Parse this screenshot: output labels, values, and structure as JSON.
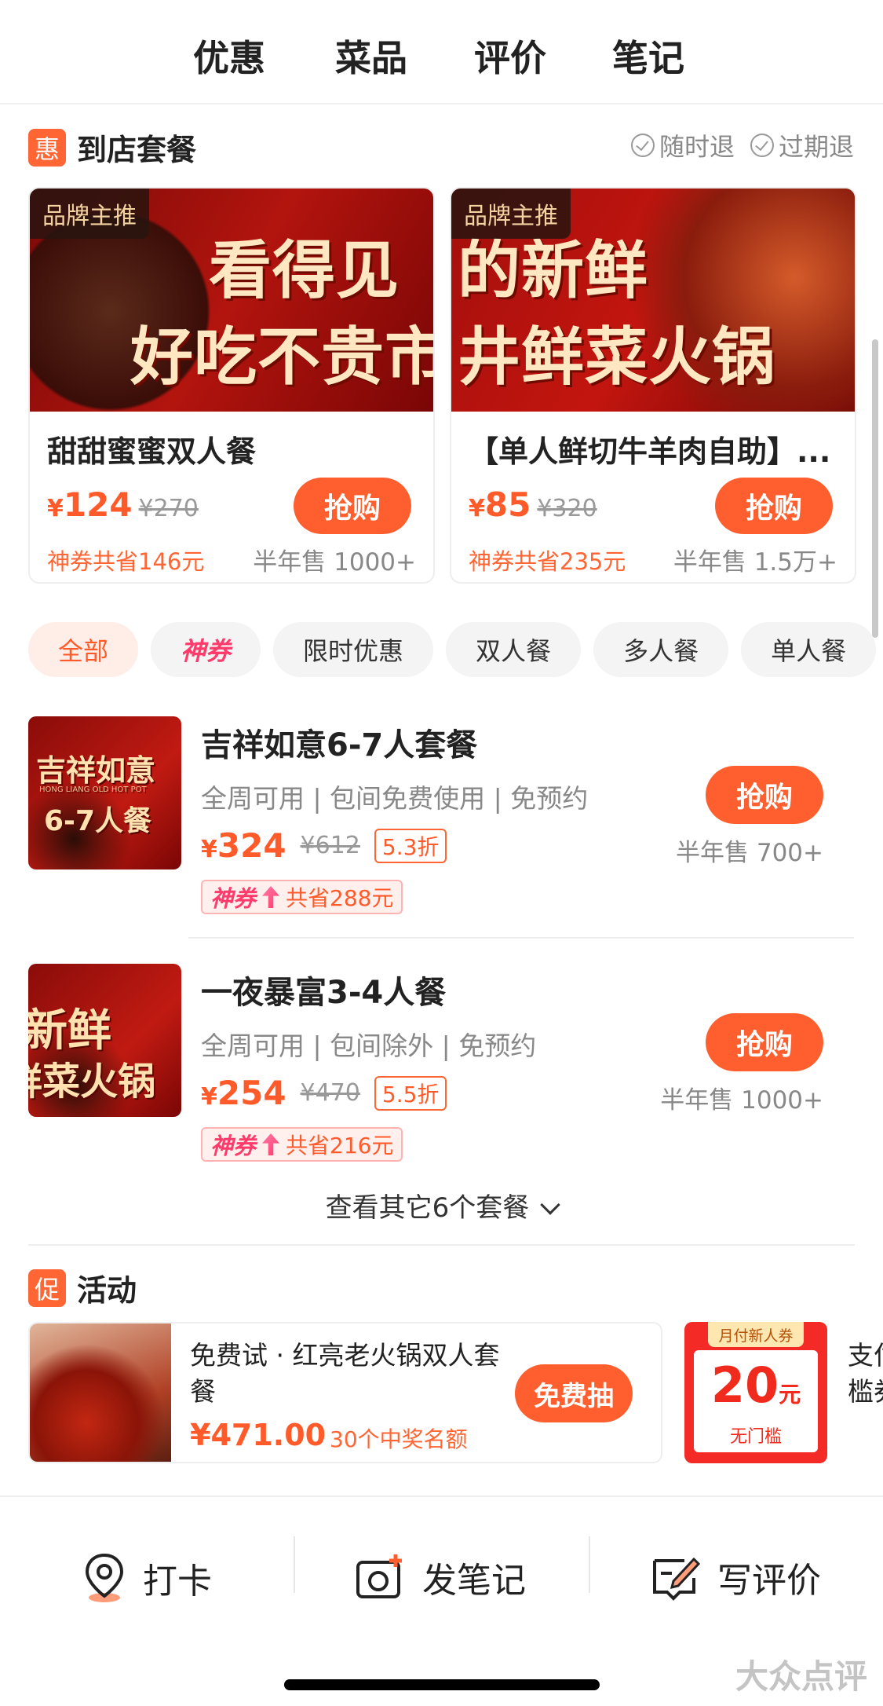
{
  "tabs": [
    {
      "label": "优惠",
      "active": true
    },
    {
      "label": "菜品",
      "active": false
    },
    {
      "label": "评价",
      "active": false
    },
    {
      "label": "笔记",
      "active": false
    }
  ],
  "package_section": {
    "badge": "惠",
    "title": "到店套餐",
    "policies": [
      "随时退",
      "过期退"
    ]
  },
  "featured": [
    {
      "tag": "品牌主推",
      "banner_line1": "看得见",
      "banner_line2": "好吃不贵市",
      "name": "甜甜蜜蜜双人餐",
      "currency": "¥",
      "price": "124",
      "original": "¥270",
      "buy": "抢购",
      "savings": "神券共省146元",
      "sold": "半年售 1000+"
    },
    {
      "tag": "品牌主推",
      "banner_line1": "的新鲜",
      "banner_line2": "井鲜菜火锅",
      "name": "【单人鲜切牛羊肉自助】...",
      "currency": "¥",
      "price": "85",
      "original": "¥320",
      "buy": "抢购",
      "savings": "神券共省235元",
      "sold": "半年售 1.5万+"
    }
  ],
  "filters": [
    {
      "label": "全部",
      "active": true
    },
    {
      "label": "神券",
      "special": true
    },
    {
      "label": "限时优惠"
    },
    {
      "label": "双人餐"
    },
    {
      "label": "多人餐"
    },
    {
      "label": "单人餐"
    }
  ],
  "deals": [
    {
      "img_line1": "吉祥如意",
      "img_line2": "6-7人餐",
      "img_small": "HONG LIANG OLD HOT POT",
      "title": "吉祥如意6-7人套餐",
      "sub": "全周可用 | 包间免费使用 | 免预约",
      "currency": "¥",
      "price": "324",
      "original": "¥612",
      "discount": "5.3折",
      "coupon_logo": "神券",
      "coupon_text": "共省288元",
      "buy": "抢购",
      "sold": "半年售 700+"
    },
    {
      "img_line1": "新鲜",
      "img_line2": "鲜菜火锅",
      "title": "一夜暴富3-4人餐",
      "sub": "全周可用 | 包间除外 | 免预约",
      "currency": "¥",
      "price": "254",
      "original": "¥470",
      "discount": "5.5折",
      "coupon_logo": "神券",
      "coupon_text": "共省216元",
      "buy": "抢购",
      "sold": "半年售 1000+"
    }
  ],
  "more_label": "查看其它6个套餐",
  "activity_section": {
    "badge": "促",
    "title": "活动",
    "card": {
      "title": "免费试 · 红亮老火锅双人套餐",
      "price": "¥471.00",
      "count": "30个中奖名额",
      "button": "免费抽"
    },
    "coupon": {
      "top": "月付新人券",
      "amount": "20",
      "unit": "元",
      "note": "无门槛"
    },
    "peek_line1": "支付",
    "peek_line2": "槛券"
  },
  "bottom_bar": [
    {
      "label": "打卡",
      "icon": "location-pin-icon"
    },
    {
      "label": "发笔记",
      "icon": "camera-plus-icon"
    },
    {
      "label": "写评价",
      "icon": "edit-review-icon"
    }
  ],
  "watermark": "大众点评",
  "colors": {
    "accent": "#ff5f2e",
    "coupon_red": "#f42a26"
  }
}
